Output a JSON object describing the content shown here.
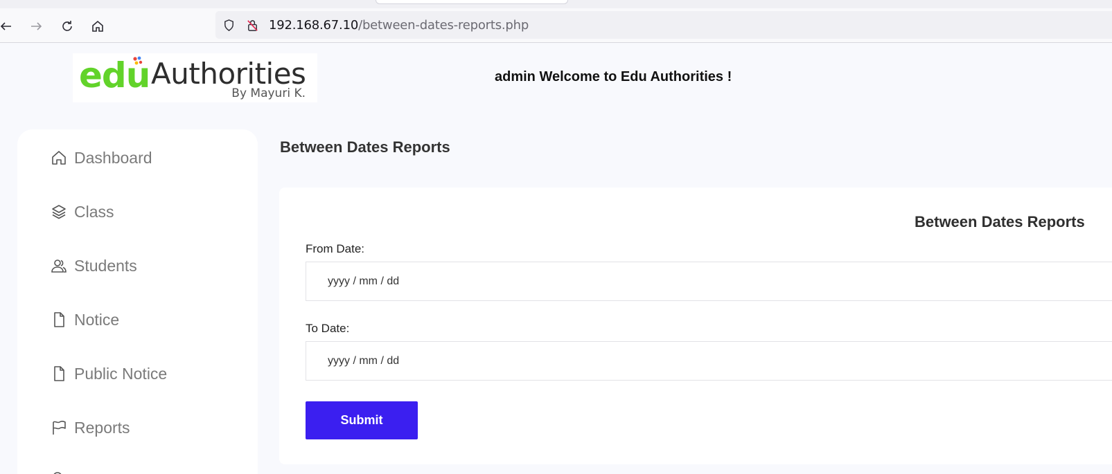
{
  "browser": {
    "url_host": "192.168.67.10",
    "url_path": "/between-dates-reports.php",
    "nav_icons": [
      "back-arrow-icon",
      "forward-arrow-icon",
      "reload-icon",
      "home-icon"
    ],
    "url_icons": [
      "shield-icon",
      "insecure-lock-icon"
    ]
  },
  "header": {
    "logo": {
      "word_edu": "edu",
      "word_authorities": "Authorities",
      "byline": "By Mayuri K."
    },
    "welcome_text": "admin Welcome to Edu Authorities !"
  },
  "sidebar": {
    "items": [
      {
        "label": "Dashboard",
        "icon": "home-icon"
      },
      {
        "label": "Class",
        "icon": "layers-icon"
      },
      {
        "label": "Students",
        "icon": "users-icon"
      },
      {
        "label": "Notice",
        "icon": "file-icon"
      },
      {
        "label": "Public Notice",
        "icon": "file-icon"
      },
      {
        "label": "Reports",
        "icon": "flag-icon"
      }
    ]
  },
  "main": {
    "page_title": "Between Dates Reports",
    "card_title": "Between Dates Reports",
    "from_label": "From Date:",
    "from_placeholder": "yyyy / mm / dd",
    "to_label": "To Date:",
    "to_placeholder": "yyyy / mm / dd",
    "submit_label": "Submit"
  },
  "colors": {
    "brand_green": "#62d32a",
    "submit_blue": "#3b1ff0",
    "page_bg": "#f8f9fd"
  }
}
